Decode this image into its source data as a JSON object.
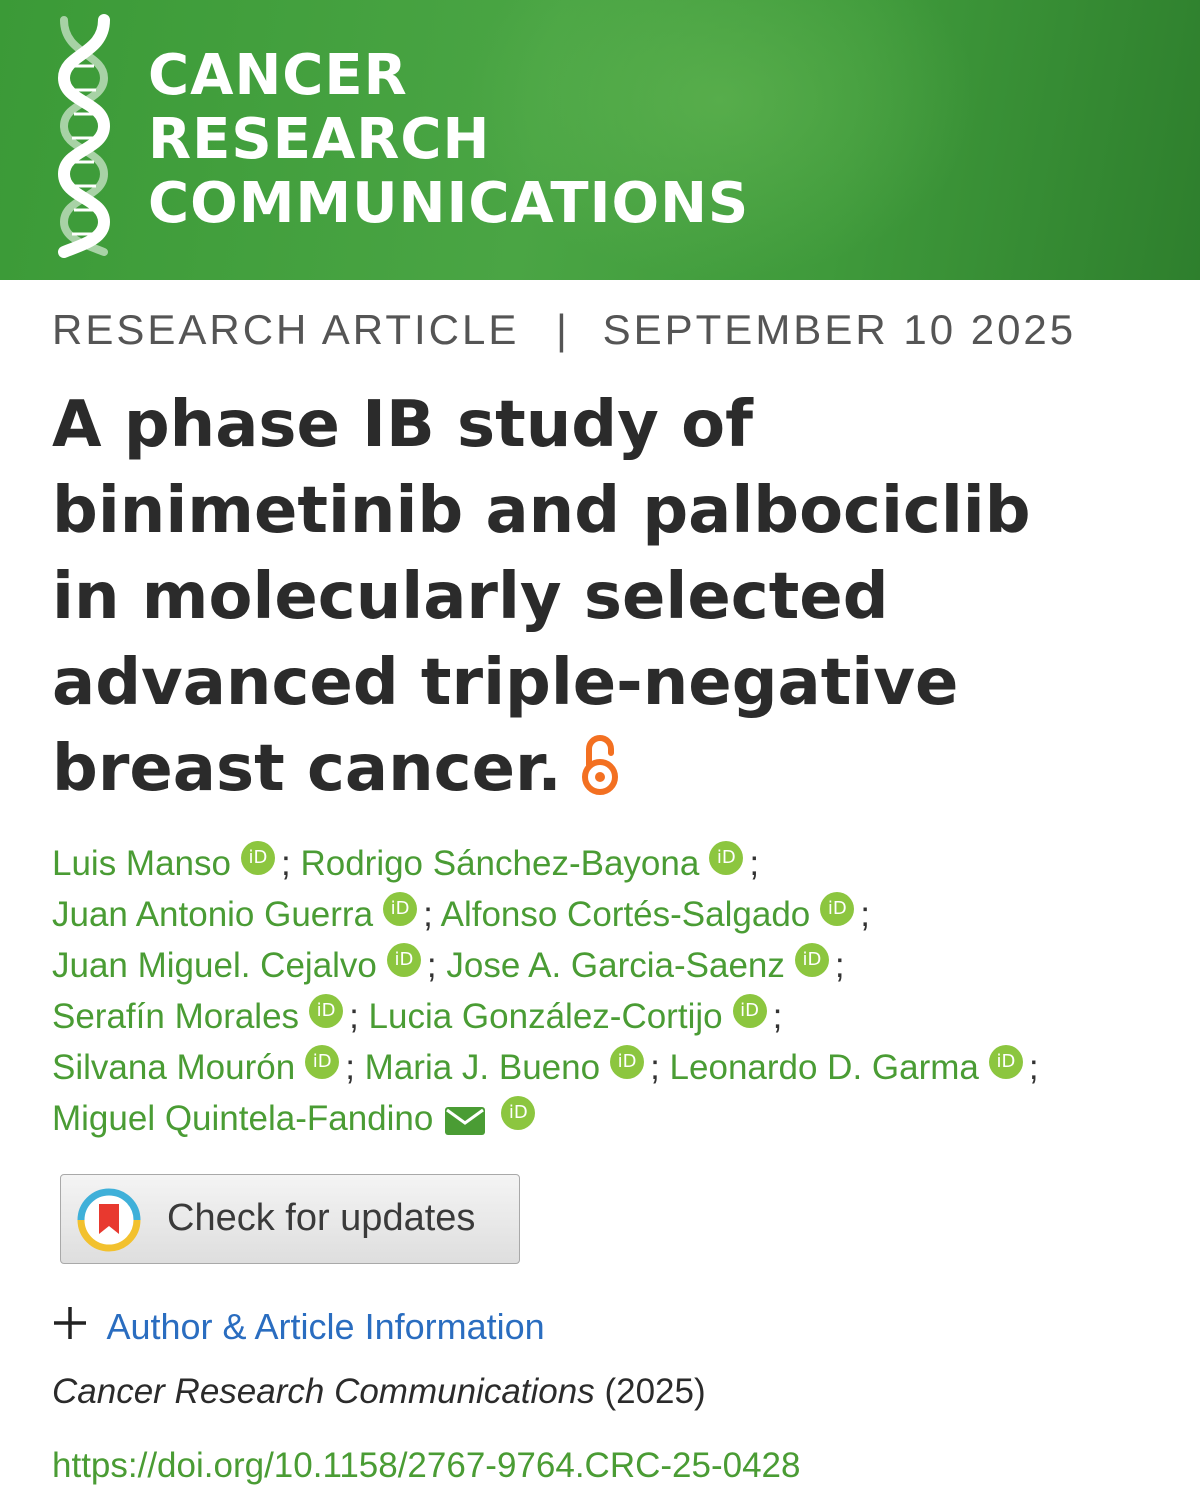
{
  "journal": {
    "name_lines": [
      "CANCER",
      "RESEARCH",
      "COMMUNICATIONS"
    ],
    "brand_color": "#3f9e3b"
  },
  "article": {
    "type": "RESEARCH ARTICLE",
    "separator": "|",
    "date": "SEPTEMBER 10 2025",
    "title_lines": [
      "A phase IB study of",
      "binimetinib and palbociclib",
      "in molecularly selected",
      "advanced triple-negative",
      "breast cancer."
    ],
    "open_access_icon": "open-access-lock-icon"
  },
  "authors": [
    "Luis Manso",
    "Rodrigo Sánchez-Bayona",
    "Juan Antonio Guerra",
    "Alfonso Cortés-Salgado",
    "Juan Miguel. Cejalvo",
    "Jose A. Garcia-Saenz",
    "Serafín Morales",
    "Lucia González-Cortijo",
    "Silvana Mourón",
    "Maria J. Bueno",
    "Leonardo D. Garma",
    "Miguel Quintela-Fandino"
  ],
  "orcid_label": "iD",
  "author_separator": ";",
  "updates_button": {
    "label": "Check for updates"
  },
  "author_info": {
    "label": "Author & Article Information"
  },
  "citation": {
    "journal": "Cancer Research Communications",
    "year": "(2025)"
  },
  "doi": "https://doi.org/10.1158/2767-9764.CRC-25-0428",
  "colors": {
    "author_green": "#4a9c34",
    "link_blue": "#2a6dc0",
    "oa_orange": "#f37021",
    "orcid_green": "#8cc63f"
  }
}
